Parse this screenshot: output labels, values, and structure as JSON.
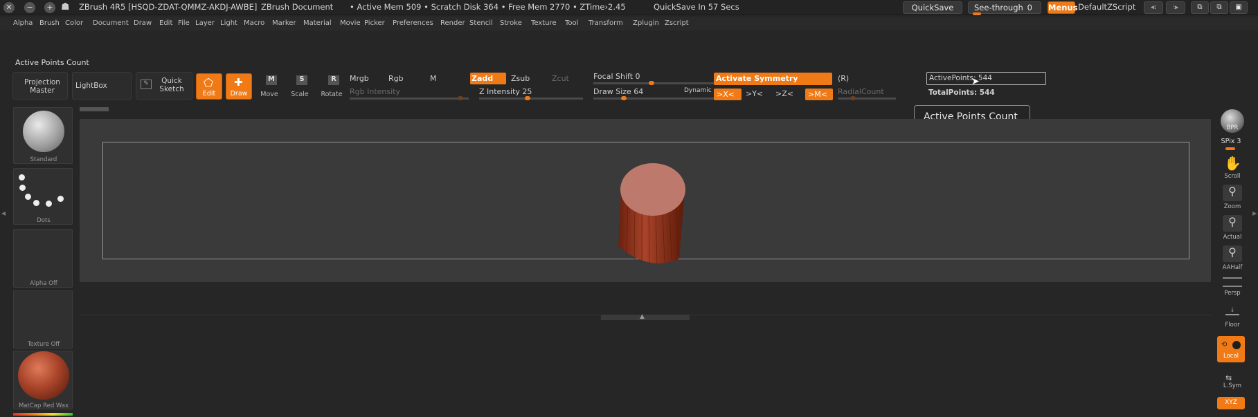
{
  "titlebar": {
    "app_title": "ZBrush 4R5 [HSQD-ZDAT-QMMZ-AKDJ-AWBE]",
    "document": "ZBrush Document",
    "status": "• Active Mem 509 • Scratch Disk 364 • Free Mem 2770 • ZTime›2.45",
    "quicksave_timer": "QuickSave In 57 Secs",
    "quicksave_label": "QuickSave",
    "seethrough_label": "See-through",
    "seethrough_value": "0",
    "menus_label": "Menus",
    "script_label": "DefaultZScript"
  },
  "menu": [
    "Alpha",
    "Brush",
    "Color",
    "Document",
    "Draw",
    "Edit",
    "File",
    "Layer",
    "Light",
    "Macro",
    "Marker",
    "Material",
    "Movie",
    "Picker",
    "Preferences",
    "Render",
    "Stencil",
    "Stroke",
    "Texture",
    "Tool",
    "Transform",
    "Zplugin",
    "Zscript"
  ],
  "shelf": {
    "title": "Active Points Count",
    "projection_master": "Projection Master",
    "lightbox": "LightBox",
    "quick_sketch": "Quick Sketch",
    "edit": "Edit",
    "draw": "Draw",
    "move": "Move",
    "scale": "Scale",
    "rotate": "Rotate",
    "mrgb": "Mrgb",
    "rgb": "Rgb",
    "m": "M",
    "zadd": "Zadd",
    "zsub": "Zsub",
    "zcut": "Zcut",
    "rgb_intensity": "Rgb Intensity",
    "z_intensity": "Z Intensity 25",
    "focal_shift": "Focal Shift 0",
    "draw_size": "Draw Size 64",
    "dynamic": "Dynamic",
    "activate_symmetry": "Activate Symmetry",
    "r_btn": "(R)",
    "x_btn": ">X<",
    "y_btn": ">Y<",
    "z_btn": ">Z<",
    "m_btn": ">M<",
    "radial_count": "RadialCount",
    "active_points": "ActivePoints: 544",
    "total_points": "TotalPoints: 544",
    "tooltip": "Active Points Count"
  },
  "left": {
    "standard": "Standard",
    "dots": "Dots",
    "alpha": "Alpha Off",
    "texture": "Texture Off",
    "matcap": "MatCap Red Wax"
  },
  "right": {
    "bpr": "BPR",
    "spix": "SPix 3",
    "scroll": "Scroll",
    "zoom": "Zoom",
    "actual": "Actual",
    "aahalf": "AAHalf",
    "persp": "Persp",
    "floor": "Floor",
    "local": "Local",
    "lsym": "L.Sym",
    "xyz": "XYZ"
  },
  "colors": {
    "accent": "#f07a16",
    "mesh": "#a9442a"
  }
}
